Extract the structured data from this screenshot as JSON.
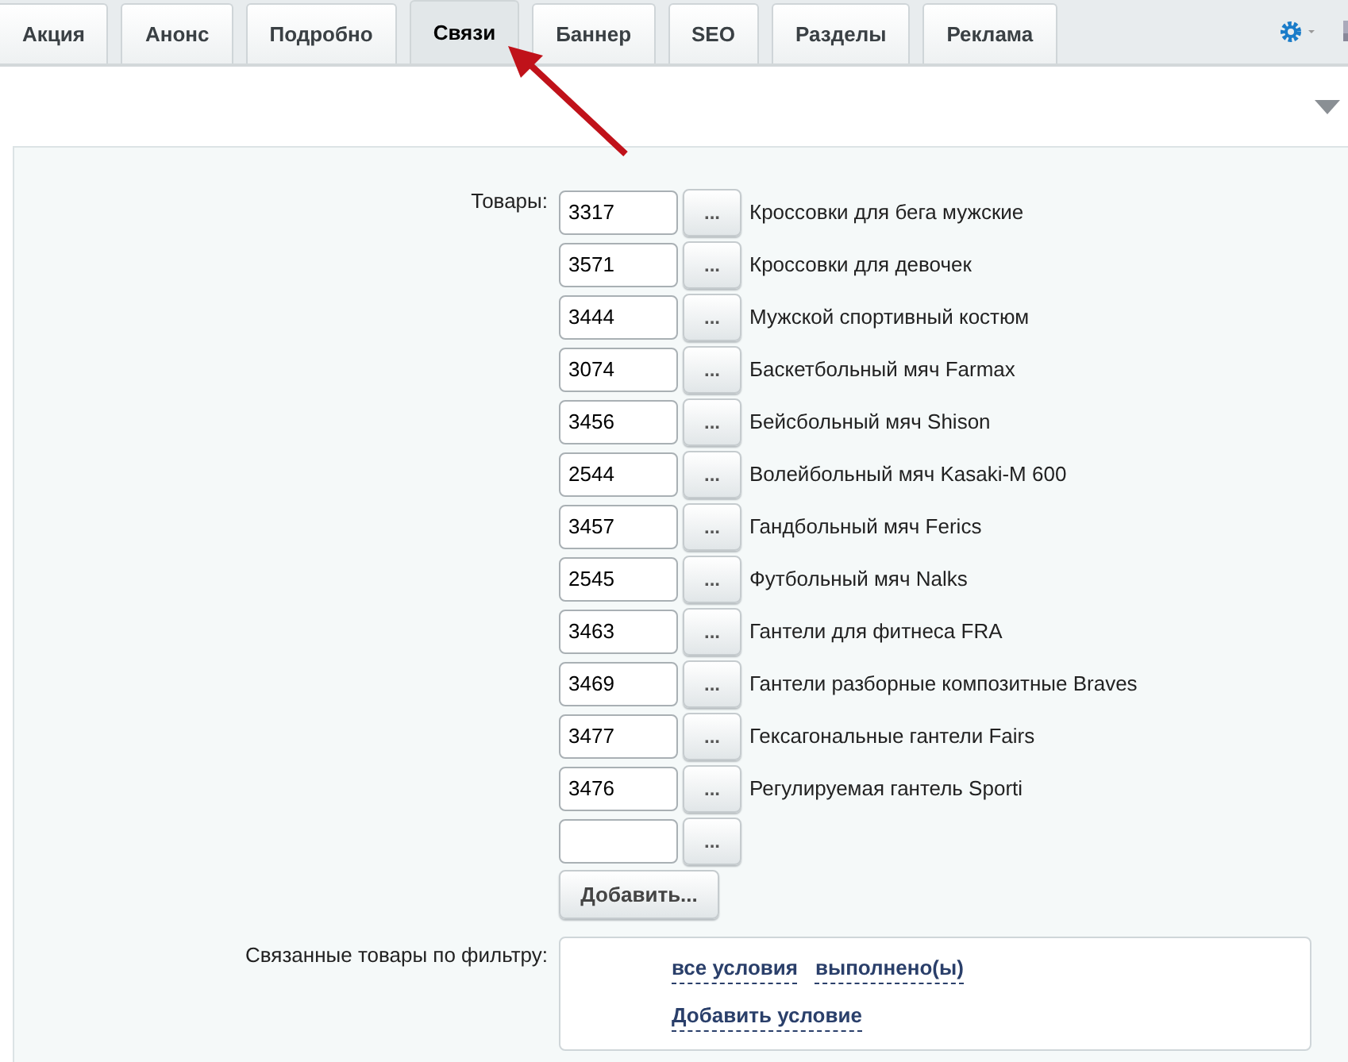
{
  "tabs": [
    {
      "label": "Акция",
      "selected": false
    },
    {
      "label": "Анонс",
      "selected": false
    },
    {
      "label": "Подробно",
      "selected": false
    },
    {
      "label": "Связи",
      "selected": true
    },
    {
      "label": "Баннер",
      "selected": false
    },
    {
      "label": "SEO",
      "selected": false
    },
    {
      "label": "Разделы",
      "selected": false
    },
    {
      "label": "Реклама",
      "selected": false
    }
  ],
  "products": {
    "label": "Товары:",
    "rows": [
      {
        "id": "3317",
        "button": "...",
        "name": "Кроссовки для бега мужские"
      },
      {
        "id": "3571",
        "button": "...",
        "name": "Кроссовки для девочек"
      },
      {
        "id": "3444",
        "button": "...",
        "name": "Мужской спортивный костюм"
      },
      {
        "id": "3074",
        "button": "...",
        "name": "Баскетбольный мяч Farmax"
      },
      {
        "id": "3456",
        "button": "...",
        "name": "Бейсбольный мяч Shison"
      },
      {
        "id": "2544",
        "button": "...",
        "name": "Волейбольный мяч Kasaki-M 600"
      },
      {
        "id": "3457",
        "button": "...",
        "name": "Гандбольный мяч Ferics"
      },
      {
        "id": "2545",
        "button": "...",
        "name": "Футбольный мяч Nalks"
      },
      {
        "id": "3463",
        "button": "...",
        "name": "Гантели для фитнеса FRA"
      },
      {
        "id": "3469",
        "button": "...",
        "name": "Гантели разборные композитные Braves"
      },
      {
        "id": "3477",
        "button": "...",
        "name": "Гексагональные гантели Fairs"
      },
      {
        "id": "3476",
        "button": "...",
        "name": "Регулируемая гантель Sporti"
      }
    ],
    "new_row": {
      "button": "..."
    },
    "add_button": "Добавить..."
  },
  "filter": {
    "label": "Связанные товары по фильтру:",
    "condition_links": [
      "все условия",
      "выполнено(ы)"
    ],
    "add_condition": "Добавить условие"
  }
}
